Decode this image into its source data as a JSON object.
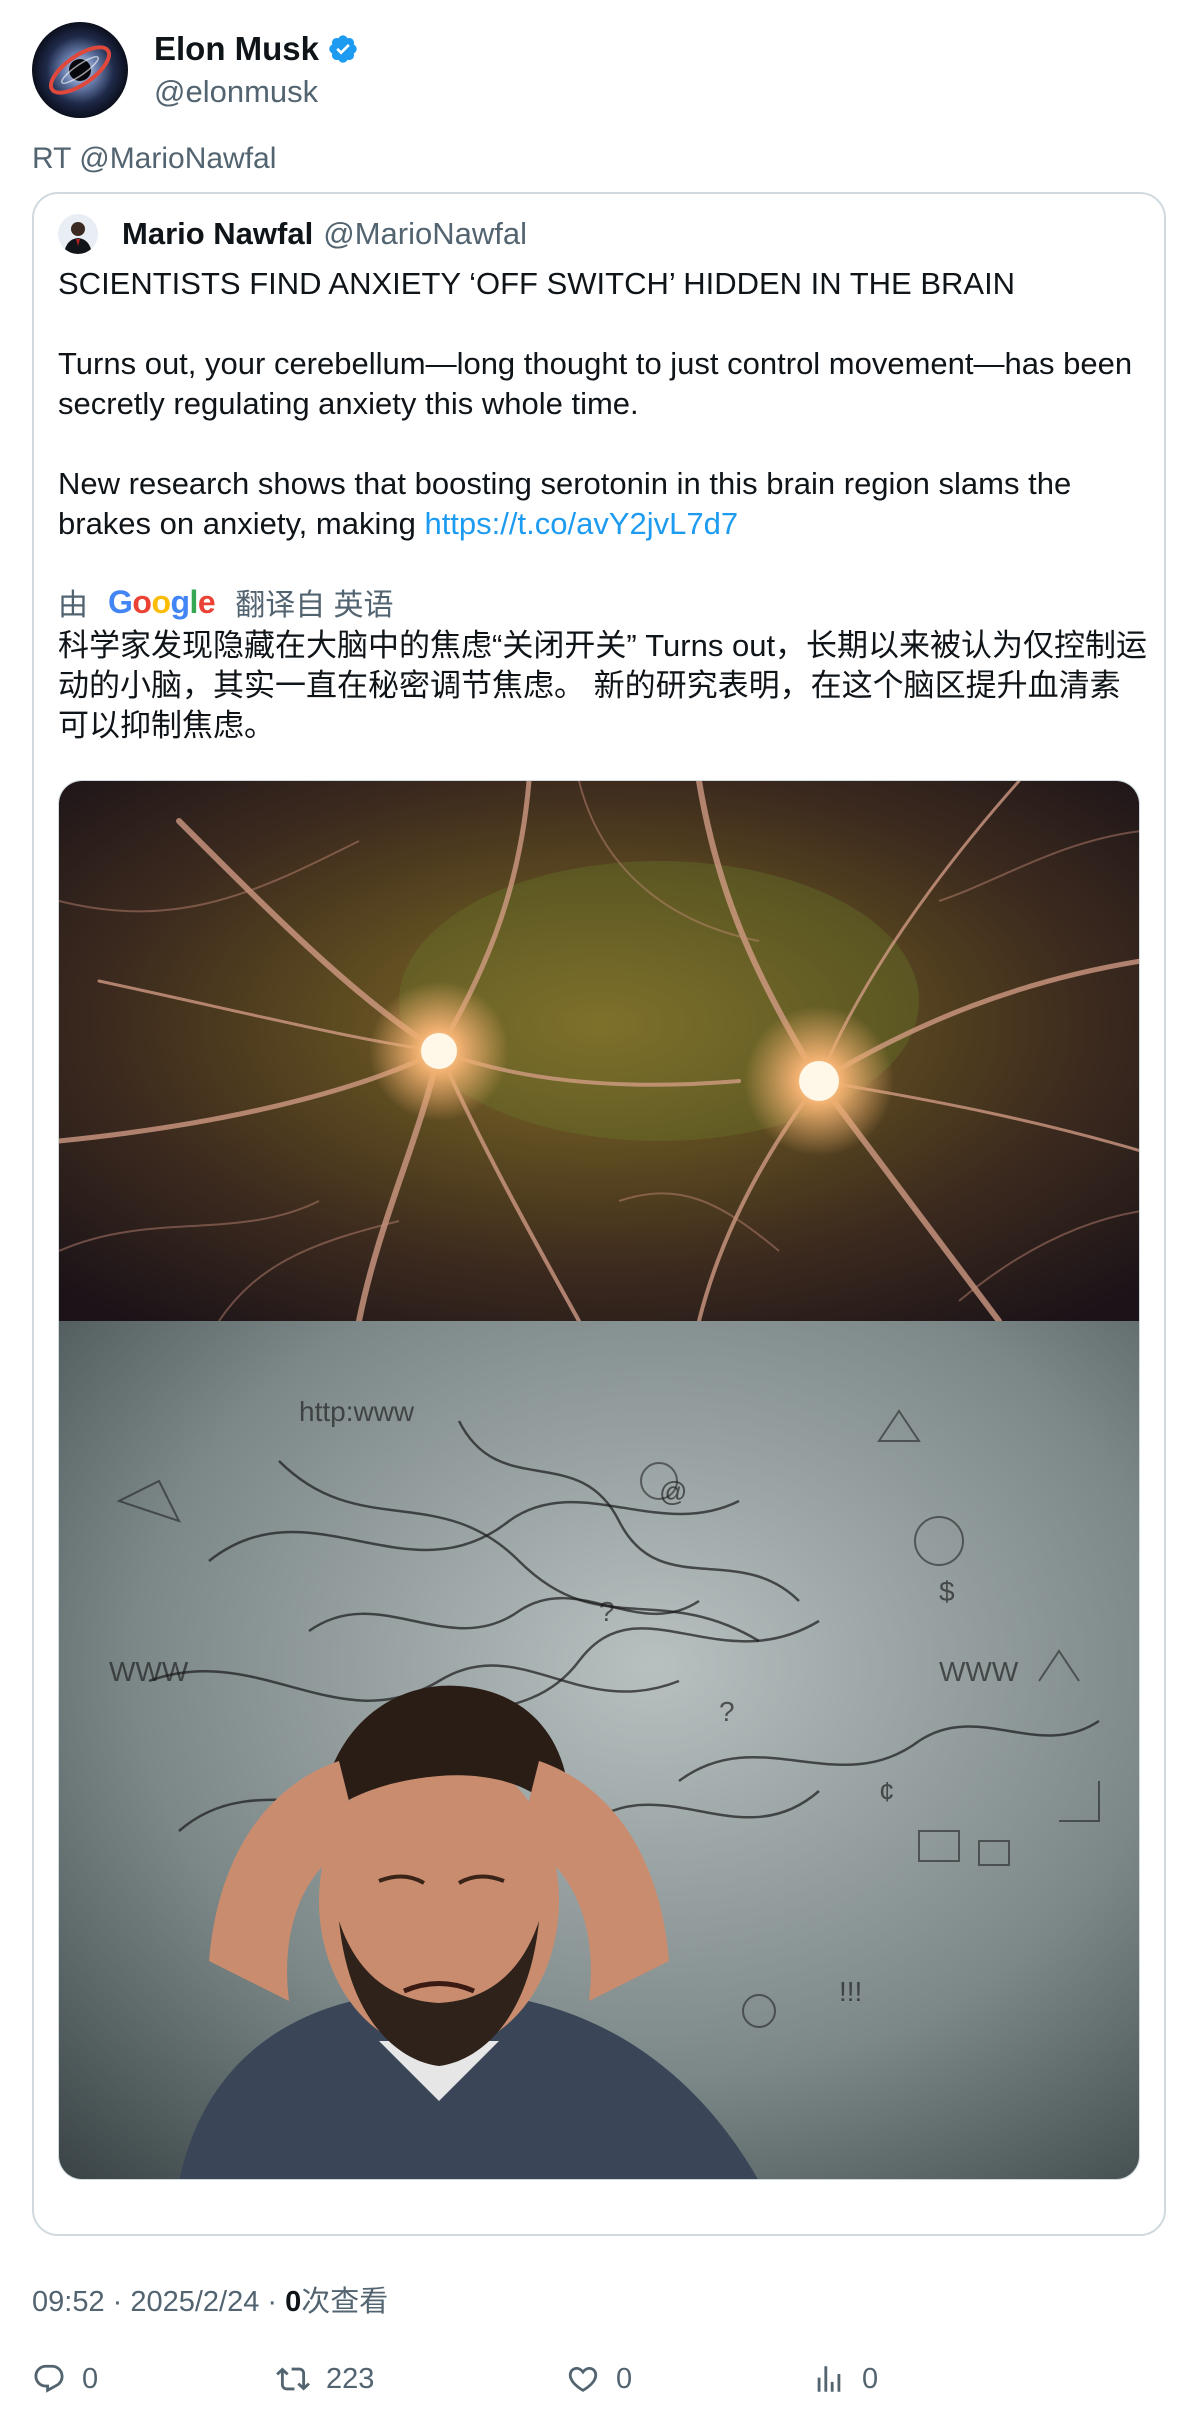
{
  "author": {
    "display_name": "Elon Musk",
    "handle": "@elonmusk",
    "verified_icon": "verified-badge-icon",
    "verified_color": "#1d9bf0"
  },
  "retweet_label": "RT @MarioNawfal",
  "quote": {
    "display_name": "Mario Nawfal",
    "handle": "@MarioNawfal",
    "headline": "SCIENTISTS FIND ANXIETY ‘OFF SWITCH’ HIDDEN IN THE BRAIN",
    "paragraph1": "Turns out, your cerebellum—long thought to just control movement—has been secretly regulating anxiety this whole time.",
    "paragraph2": "New research shows that boosting serotonin in this brain region slams the brakes on anxiety, making ",
    "link": "https://t.co/avY2jvL7d7",
    "translate_prefix": "由",
    "translate_brand": [
      "G",
      "o",
      "o",
      "g",
      "l",
      "e"
    ],
    "translate_suffix": "翻译自 英语",
    "translated_text": "科学家发现隐藏在大脑中的焦虑“关闭开关” Turns out，长期以来被认为仅控制运动的小脑，其实一直在秘密调节焦虑。 新的研究表明，在这个脑区提升血清素可以抑制焦虑。"
  },
  "meta": {
    "time": "09:52",
    "sep1": " · ",
    "date": "2025/2/24",
    "sep2": " · ",
    "views_count": "0",
    "views_label": "次查看"
  },
  "actions": {
    "reply_count": "0",
    "retweet_count": "223",
    "like_count": "0",
    "views_count": "0"
  },
  "colors": {
    "link": "#1d9bf0",
    "secondary_text": "#536471",
    "border": "#cfd9de"
  }
}
